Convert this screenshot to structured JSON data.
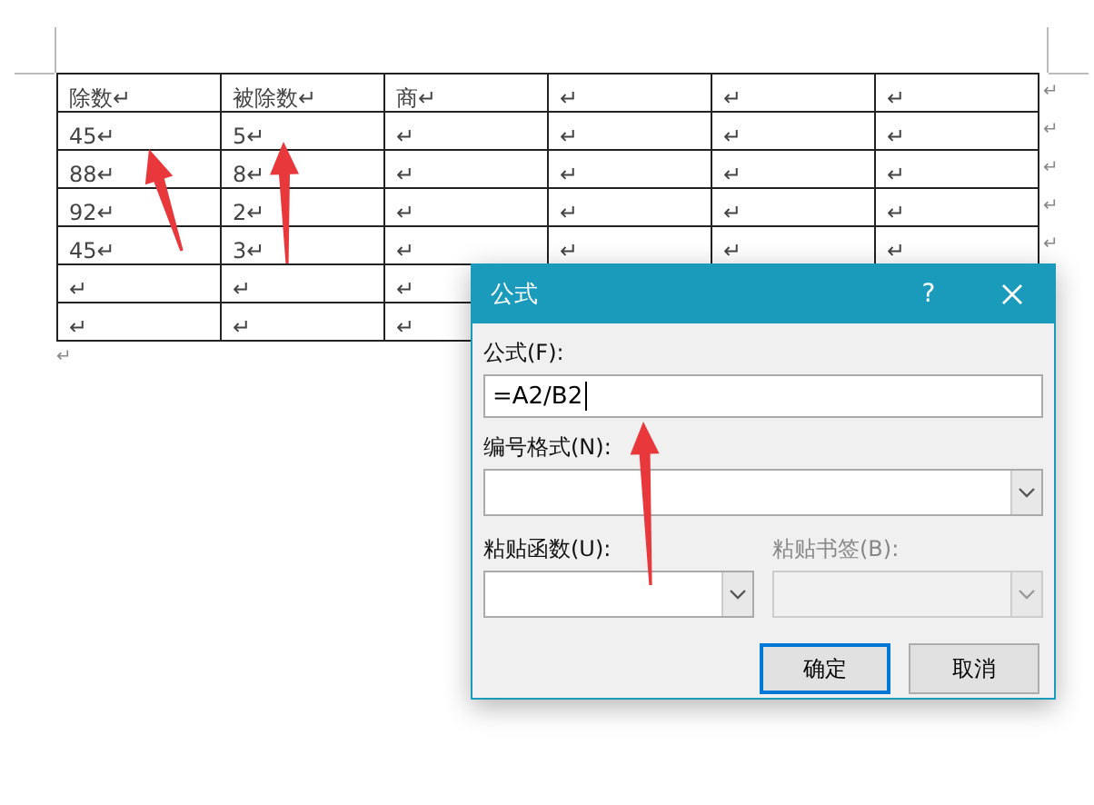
{
  "document": {
    "table": {
      "rows": [
        {
          "cells": [
            "除数↵",
            "被除数↵",
            "商↵",
            "↵",
            "↵",
            "↵"
          ],
          "end_mark": "↵"
        },
        {
          "cells": [
            "45↵",
            "5↵",
            "↵",
            "↵",
            "↵",
            "↵"
          ],
          "end_mark": "↵"
        },
        {
          "cells": [
            "88↵",
            "8↵",
            "↵",
            "↵",
            "↵",
            "↵"
          ],
          "end_mark": "↵"
        },
        {
          "cells": [
            "92↵",
            "2↵",
            "↵",
            "↵",
            "↵",
            "↵"
          ],
          "end_mark": "↵"
        },
        {
          "cells": [
            "45↵",
            "3↵",
            "↵",
            "↵",
            "↵",
            "↵"
          ],
          "end_mark": "↵"
        },
        {
          "cells": [
            "↵",
            "↵",
            "↵"
          ]
        },
        {
          "cells": [
            "↵",
            "↵",
            "↵"
          ]
        }
      ]
    },
    "paragraph_mark": "↵"
  },
  "dialog": {
    "title": "公式",
    "help": "?",
    "formula": {
      "label": "公式(F):",
      "value": "=A2/B2"
    },
    "number_format": {
      "label": "编号格式(N):"
    },
    "paste_function": {
      "label": "粘贴函数(U):",
      "disabled": false
    },
    "paste_bookmark": {
      "label": "粘贴书签(B):",
      "disabled": true
    },
    "buttons": [
      {
        "label": "确定",
        "default": true
      },
      {
        "label": "取消",
        "default": false
      }
    ]
  }
}
